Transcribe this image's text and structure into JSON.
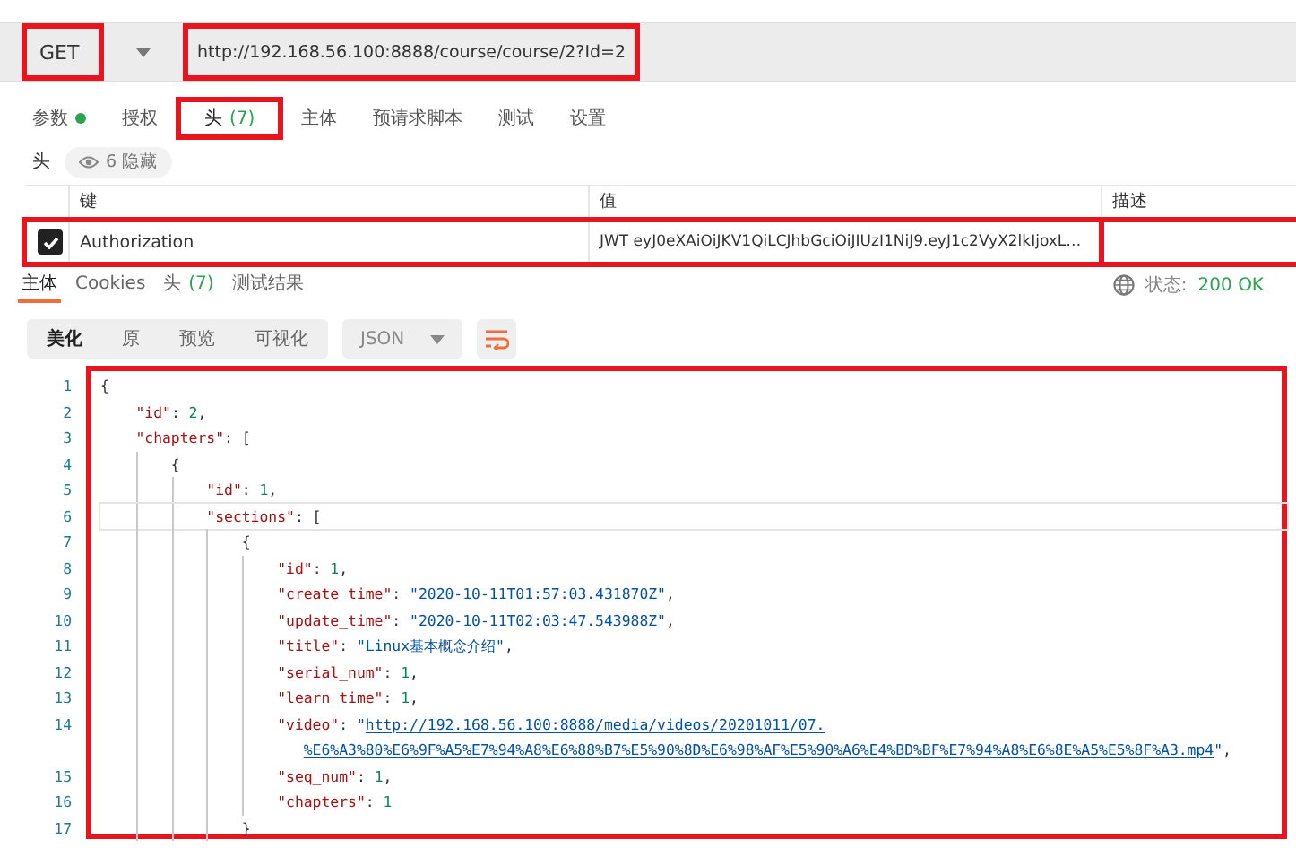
{
  "request": {
    "method": {
      "text": "GET",
      "highlighted": true
    },
    "url": {
      "text": "http://192.168.56.100:8888/course/course/2?Id=2",
      "highlighted": true
    }
  },
  "request_tabs": [
    {
      "label": "参数",
      "dot": true,
      "selected": false,
      "highlighted": false
    },
    {
      "label": "授权",
      "dot": false,
      "selected": false,
      "highlighted": false
    },
    {
      "label": "头",
      "count": "(7)",
      "dot": false,
      "selected": true,
      "highlighted": true
    },
    {
      "label": "主体",
      "dot": false,
      "selected": false,
      "highlighted": false
    },
    {
      "label": "预请求脚本",
      "dot": false,
      "selected": false,
      "highlighted": false
    },
    {
      "label": "测试",
      "dot": false,
      "selected": false,
      "highlighted": false
    },
    {
      "label": "设置",
      "dot": false,
      "selected": false,
      "highlighted": false
    }
  ],
  "headers_bar": {
    "label": "头",
    "hidden_toggle": "6 隐藏"
  },
  "headers_table": {
    "columns": [
      "键",
      "值",
      "描述"
    ],
    "rows": [
      {
        "checked": true,
        "key": "Authorization",
        "value": "JWT eyJ0eXAiOiJKV1QiLCJhbGciOiJIUzI1NiJ9.eyJ1c2VyX2lkIjoxL…",
        "highlighted": true
      }
    ]
  },
  "response_tabs": [
    {
      "label": "主体",
      "selected": true
    },
    {
      "label": "Cookies",
      "selected": false
    },
    {
      "label": "头",
      "count": "(7)",
      "selected": false
    },
    {
      "label": "测试结果",
      "selected": false
    }
  ],
  "status": {
    "label": "状态:",
    "value": "200 OK"
  },
  "view_modes": [
    {
      "label": "美化",
      "selected": true
    },
    {
      "label": "原",
      "selected": false
    },
    {
      "label": "预览",
      "selected": false
    },
    {
      "label": "可视化",
      "selected": false
    }
  ],
  "format": "JSON",
  "wrap_lines": true,
  "editor": {
    "highlighted": true,
    "lines": [
      {
        "number": "1",
        "current": false,
        "tokens": [
          {
            "kind": "punct",
            "text": "{"
          }
        ]
      },
      {
        "number": "2",
        "current": false,
        "tokens": [
          {
            "kind": "key",
            "text": "    \"id\""
          },
          {
            "kind": "punct",
            "text": ": "
          },
          {
            "kind": "number",
            "text": "2"
          },
          {
            "kind": "punct",
            "text": ","
          }
        ]
      },
      {
        "number": "3",
        "current": false,
        "tokens": [
          {
            "kind": "key",
            "text": "    \"chapters\""
          },
          {
            "kind": "punct",
            "text": ": ["
          }
        ]
      },
      {
        "number": "4",
        "current": false,
        "tokens": [
          {
            "kind": "punct",
            "text": "        {"
          }
        ]
      },
      {
        "number": "5",
        "current": false,
        "tokens": [
          {
            "kind": "key",
            "text": "            \"id\""
          },
          {
            "kind": "punct",
            "text": ": "
          },
          {
            "kind": "number",
            "text": "1"
          },
          {
            "kind": "punct",
            "text": ","
          }
        ]
      },
      {
        "number": "6",
        "current": true,
        "tokens": [
          {
            "kind": "key",
            "text": "            \"sections\""
          },
          {
            "kind": "punct",
            "text": ": ["
          }
        ]
      },
      {
        "number": "7",
        "current": false,
        "tokens": [
          {
            "kind": "punct",
            "text": "                {"
          }
        ]
      },
      {
        "number": "8",
        "current": false,
        "tokens": [
          {
            "kind": "key",
            "text": "                    \"id\""
          },
          {
            "kind": "punct",
            "text": ": "
          },
          {
            "kind": "number",
            "text": "1"
          },
          {
            "kind": "punct",
            "text": ","
          }
        ]
      },
      {
        "number": "9",
        "current": false,
        "tokens": [
          {
            "kind": "key",
            "text": "                    \"create_time\""
          },
          {
            "kind": "punct",
            "text": ": "
          },
          {
            "kind": "string",
            "text": "\"2020-10-11T01:57:03.431870Z\""
          },
          {
            "kind": "punct",
            "text": ","
          }
        ]
      },
      {
        "number": "10",
        "current": false,
        "tokens": [
          {
            "kind": "key",
            "text": "                    \"update_time\""
          },
          {
            "kind": "punct",
            "text": ": "
          },
          {
            "kind": "string",
            "text": "\"2020-10-11T02:03:47.543988Z\""
          },
          {
            "kind": "punct",
            "text": ","
          }
        ]
      },
      {
        "number": "11",
        "current": false,
        "tokens": [
          {
            "kind": "key",
            "text": "                    \"title\""
          },
          {
            "kind": "punct",
            "text": ": "
          },
          {
            "kind": "string",
            "text": "\"Linux基本概念介绍\""
          },
          {
            "kind": "punct",
            "text": ","
          }
        ]
      },
      {
        "number": "12",
        "current": false,
        "tokens": [
          {
            "kind": "key",
            "text": "                    \"serial_num\""
          },
          {
            "kind": "punct",
            "text": ": "
          },
          {
            "kind": "number",
            "text": "1"
          },
          {
            "kind": "punct",
            "text": ","
          }
        ]
      },
      {
        "number": "13",
        "current": false,
        "tokens": [
          {
            "kind": "key",
            "text": "                    \"learn_time\""
          },
          {
            "kind": "punct",
            "text": ": "
          },
          {
            "kind": "number",
            "text": "1"
          },
          {
            "kind": "punct",
            "text": ","
          }
        ]
      },
      {
        "number": "14",
        "current": false,
        "tokens": [
          {
            "kind": "key",
            "text": "                    \"video\""
          },
          {
            "kind": "punct",
            "text": ": "
          },
          {
            "kind": "string",
            "text": "\""
          },
          {
            "kind": "link",
            "text": "http://192.168.56.100:8888/media/videos/20201011/07."
          }
        ]
      },
      {
        "current": false,
        "tokens": [
          {
            "kind": "link",
            "text": "                       %E6%A3%80%E6%9F%A5%E7%94%A8%E6%88%B7%E5%90%8D%E6%98%AF%E5%90%A6%E4%BD%BF%E7%94%A8%E6%8E%A5%E5%8F%A3.mp4"
          },
          {
            "kind": "string",
            "text": "\""
          },
          {
            "kind": "punct",
            "text": ","
          }
        ]
      },
      {
        "number": "15",
        "current": false,
        "tokens": [
          {
            "kind": "key",
            "text": "                    \"seq_num\""
          },
          {
            "kind": "punct",
            "text": ": "
          },
          {
            "kind": "number",
            "text": "1"
          },
          {
            "kind": "punct",
            "text": ","
          }
        ]
      },
      {
        "number": "16",
        "current": false,
        "tokens": [
          {
            "kind": "key",
            "text": "                    \"chapters\""
          },
          {
            "kind": "punct",
            "text": ": "
          },
          {
            "kind": "number",
            "text": "1"
          }
        ]
      },
      {
        "number": "17",
        "current": false,
        "tokens": [
          {
            "kind": "punct",
            "text": "                }"
          }
        ]
      }
    ]
  }
}
